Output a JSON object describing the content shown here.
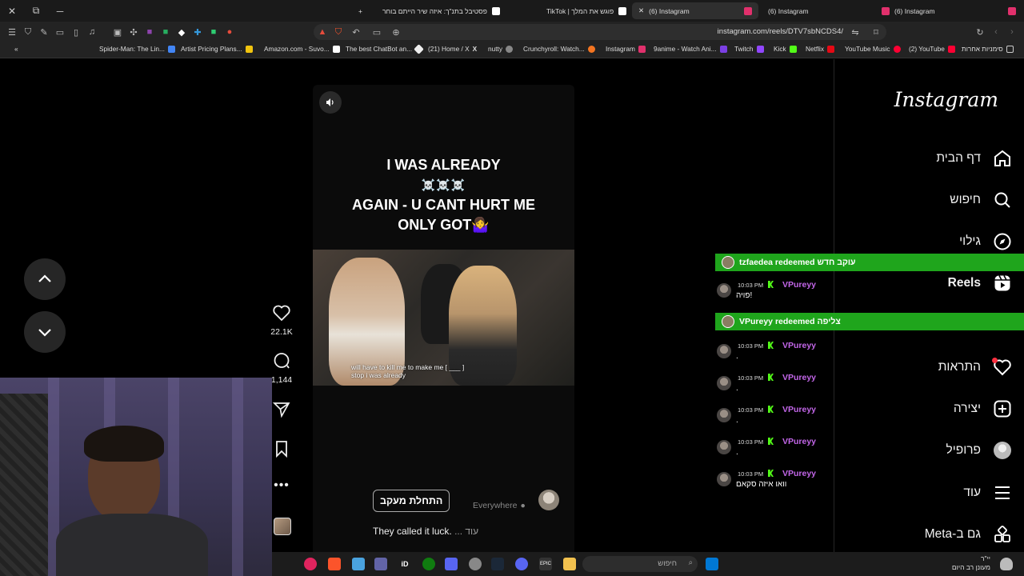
{
  "browser": {
    "tabs": [
      {
        "label": "פסטיבל בתנ\"ך: איזה שיר הייתם בוחר",
        "active": false,
        "favicon_color": "#ffffff"
      },
      {
        "label": "TikTok | פוגש את המלך",
        "active": false,
        "favicon_color": "#ffffff"
      },
      {
        "label": "(6) Instagram",
        "active": true,
        "favicon_color": "#e1306c"
      },
      {
        "label": "(6) Instagram",
        "active": false,
        "favicon_color": "#e1306c"
      },
      {
        "label": "(6) Instagram",
        "active": false,
        "favicon_color": "#e1306c"
      }
    ],
    "url": "instagram.com/reels/DTV7sbNCDS4/",
    "bookmarks": [
      "Spider-Man: The Lin...",
      "Artist Pricing Plans...",
      "Amazon.com - Suvo...",
      "The best ChatBot an...",
      "(21) Home / X",
      "nutty",
      "Crunchyroll: Watch...",
      "Instagram",
      "9anime - Watch Ani...",
      "Twitch",
      "Kick",
      "Netflix",
      "YouTube Music",
      "(2) YouTube",
      "סימניות אחרות"
    ]
  },
  "reel": {
    "caption_line1": "I WAS ALREADY",
    "caption_skulls": "☠️☠️☠️",
    "caption_line2": "AGAIN - U CANT HURT ME",
    "caption_line3": "ONLY GOT🤷‍♀️",
    "subtitle_line1": "will have to kill me to make me [ ___ ]",
    "subtitle_line2": "stop i was already",
    "follow_label": "התחלת מעקב",
    "location": "Everywhere",
    "description": "They called it luck.",
    "more_label": "... עוד",
    "likes": "22.1K",
    "comments": "1,144"
  },
  "ig_nav": {
    "logo": "Instagram",
    "items": [
      {
        "label": "דף הבית",
        "icon": "home-icon"
      },
      {
        "label": "חיפוש",
        "icon": "search-icon"
      },
      {
        "label": "גילוי",
        "icon": "compass-icon"
      },
      {
        "label": "Reels",
        "icon": "reels-icon"
      },
      {
        "label": "התראות",
        "icon": "heart-icon"
      },
      {
        "label": "יצירה",
        "icon": "plus-square-icon"
      },
      {
        "label": "פרופיל",
        "icon": "avatar"
      },
      {
        "label": "עוד",
        "icon": "menu-icon"
      },
      {
        "label": "Meta-גם ב",
        "icon": "meta-apps-icon"
      }
    ]
  },
  "chat": {
    "redeems": [
      {
        "text": "tzfaedea redeemed עוקב חדש"
      },
      {
        "text": "VPureyy redeemed צליפה"
      }
    ],
    "messages": [
      {
        "time": "10:03 PM",
        "user": "VPureyy",
        "text": "פויה!"
      },
      {
        "time": "10:03 PM",
        "user": "VPureyy",
        "text": "."
      },
      {
        "time": "10:03 PM",
        "user": "VPureyy",
        "text": "."
      },
      {
        "time": "10:03 PM",
        "user": "VPureyy",
        "text": "."
      },
      {
        "time": "10:03 PM",
        "user": "VPureyy",
        "text": "."
      },
      {
        "time": "10:03 PM",
        "user": "VPureyy",
        "text": "וואו איזה סקאם"
      }
    ],
    "accent_color": "#1fa51c",
    "username_color": "#c266e8"
  },
  "taskbar": {
    "search_placeholder": "חיפוש",
    "clock_time": "יי\"ר",
    "clock_weather": "מעונן רב היום"
  }
}
